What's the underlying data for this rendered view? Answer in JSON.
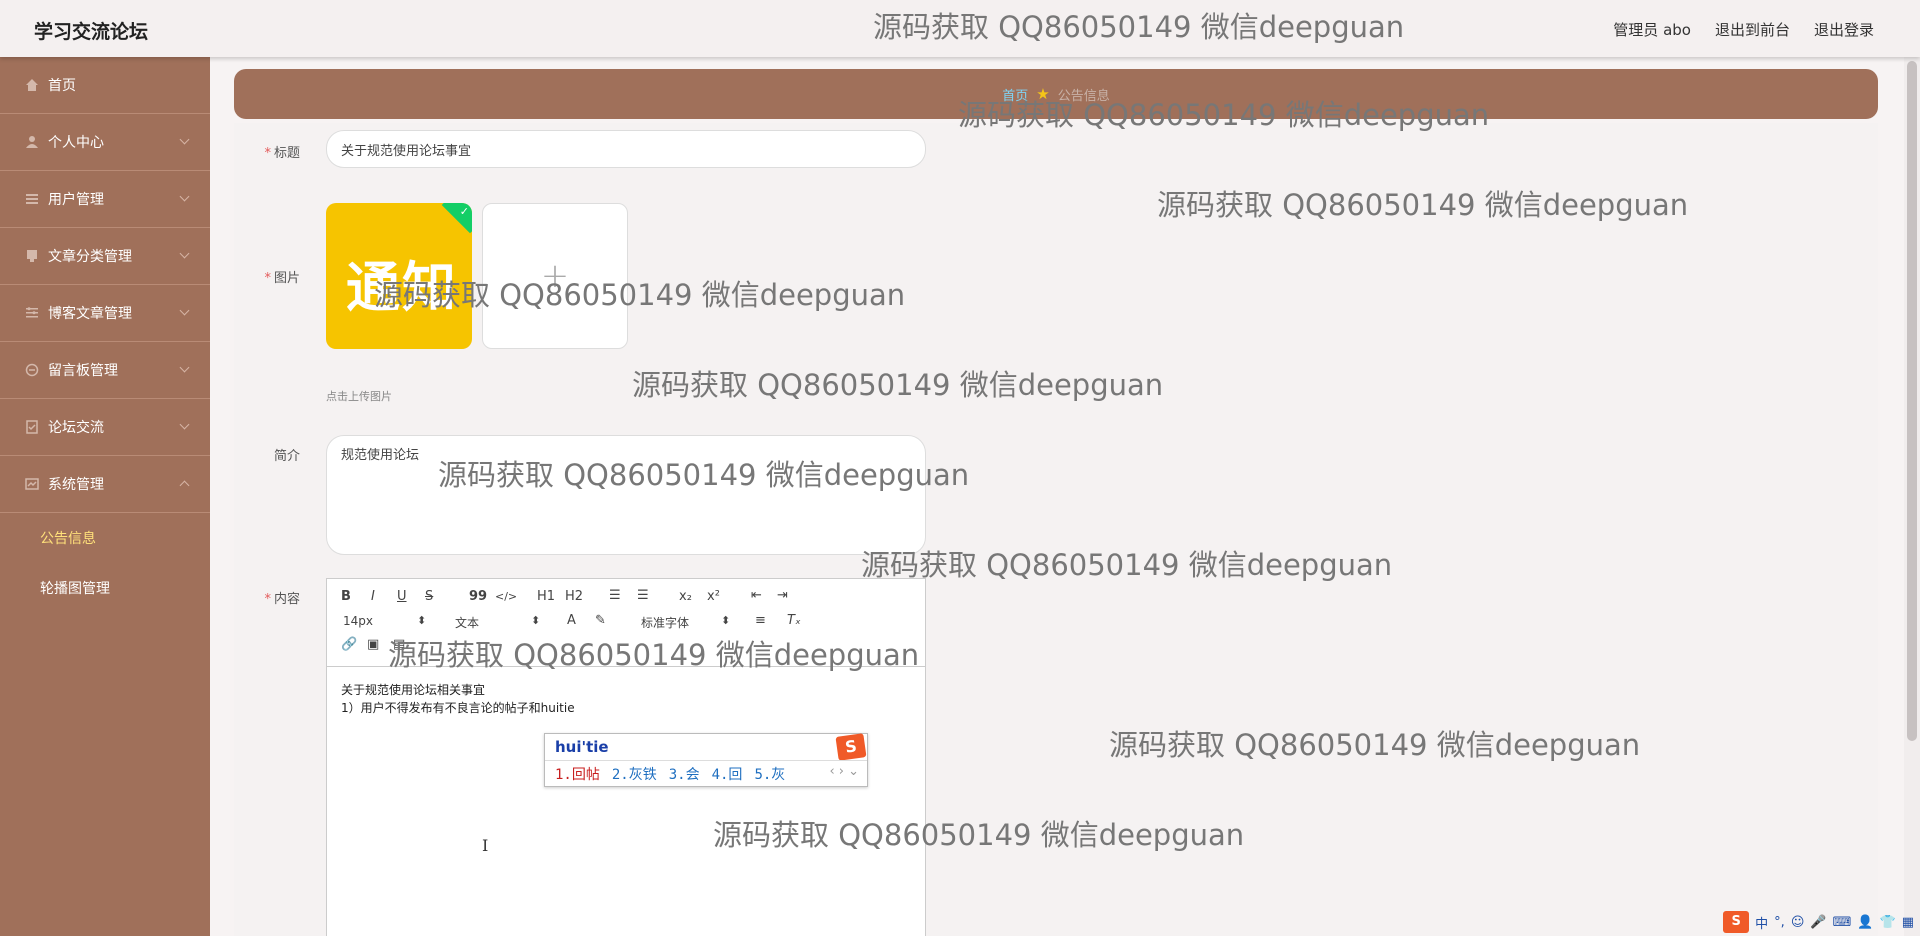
{
  "app": {
    "title": "学习交流论坛"
  },
  "top_links": {
    "admin": "管理员 abo",
    "frontend": "退出到前台",
    "logout": "退出登录"
  },
  "sidebar": {
    "items": [
      {
        "label": "首页",
        "icon": "home-icon"
      },
      {
        "label": "个人中心",
        "icon": "user-icon"
      },
      {
        "label": "用户管理",
        "icon": "list-icon"
      },
      {
        "label": "文章分类管理",
        "icon": "category-icon"
      },
      {
        "label": "博客文章管理",
        "icon": "article-icon"
      },
      {
        "label": "留言板管理",
        "icon": "message-icon"
      },
      {
        "label": "论坛交流",
        "icon": "forum-icon"
      },
      {
        "label": "系统管理",
        "icon": "settings-icon"
      }
    ],
    "sub_items": [
      {
        "label": "公告信息",
        "active": true
      },
      {
        "label": "轮播图管理",
        "active": false
      }
    ]
  },
  "breadcrumb": {
    "home": "首页",
    "current": "公告信息"
  },
  "form": {
    "title_label": "标题",
    "title_value": "关于规范使用论坛事宜",
    "image_label": "图片",
    "thumbnail_text": "通知",
    "upload_hint": "点击上传图片",
    "intro_label": "简介",
    "intro_value": "规范使用论坛",
    "content_label": "内容",
    "required_mark": "*"
  },
  "editor": {
    "toolbar": {
      "bold": "B",
      "italic": "I",
      "underline": "U",
      "strike": "S",
      "quote": "99",
      "code": "</>",
      "h1": "H1",
      "h2": "H2",
      "subscript": "x₂",
      "superscript": "x²",
      "font_size": "14px",
      "font_family": "标准字体",
      "text_label": "文本"
    },
    "lines": [
      "关于规范使用论坛相关事宜",
      "1）用户不得发布有不良言论的帖子和huitie"
    ]
  },
  "ime": {
    "input": "hui'tie",
    "candidates": [
      "1.回帖",
      "2.灰铁",
      "3.会",
      "4.回",
      "5.灰"
    ]
  },
  "watermark": "源码获取 QQ86050149 微信deepguan",
  "tray": {
    "lang": "中"
  },
  "colors": {
    "sidebar": "#a0705a",
    "active_sub": "#ffe07a",
    "crumb_home": "#7fd4f4",
    "required": "#e35a5a"
  }
}
